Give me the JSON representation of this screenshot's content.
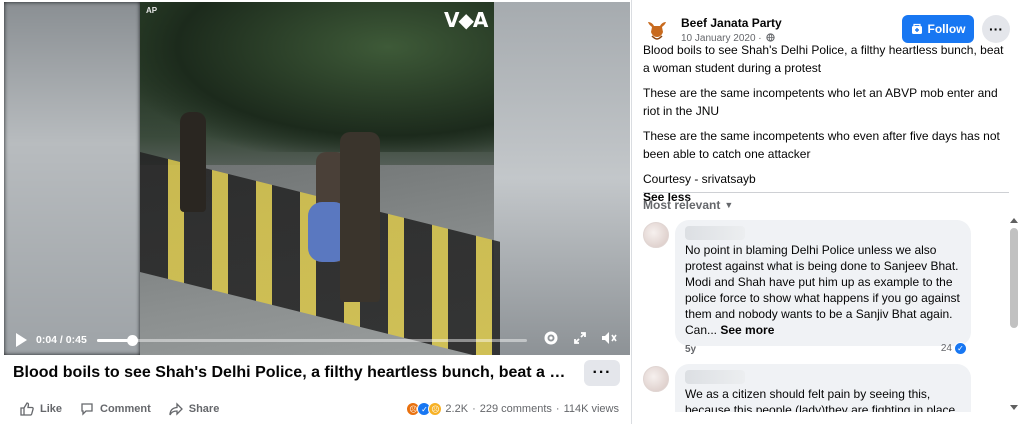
{
  "video": {
    "agency_mark": "AP",
    "channel_logo": "V◆A",
    "time_current": "0:04",
    "time_total": "0:45",
    "progress": 0.083,
    "icons": [
      "play-icon",
      "settings-icon",
      "fullscreen-icon",
      "volume-icon"
    ]
  },
  "post": {
    "title": "Blood boils to see Shah's Delhi Police, a filthy heartless bunch, beat a w...",
    "more_label": "···",
    "actions": {
      "like": "Like",
      "comment": "Comment",
      "share": "Share"
    },
    "stats": {
      "reactions_count": "2.2K",
      "comments": "229 comments",
      "views": "114K views",
      "separator": "·"
    }
  },
  "panel": {
    "page_name": "Beef Janata Party",
    "date": "10 January 2020 ·",
    "follow_label": "Follow",
    "menu_label": "···",
    "body": [
      "Blood boils to see Shah's Delhi Police, a filthy heartless bunch, beat a woman student during a protest",
      "These are the same incompetents who let an ABVP mob enter and riot in the JNU",
      "These are the same incompetents who even after five days has not been able to catch one attacker",
      "Courtesy - srivatsayb"
    ],
    "see_less": "See less",
    "sort_label": "Most relevant",
    "comments": [
      {
        "text": "No point in blaming Delhi Police unless we also protest against what is being done to Sanjeev Bhat. Modi and Shah have put him up as example to the police force to show what happens if you go against them and nobody wants to be a Sanjiv Bhat again. Can...",
        "see_more": "See more",
        "age": "5y",
        "likes": "24"
      },
      {
        "text": "We as a citizen should felt pain by seeing this, because this people (lady)they are fighting in place",
        "see_more": "",
        "age": "",
        "likes": ""
      }
    ]
  },
  "colors": {
    "brand_blue": "#1877f2",
    "secondary_text": "#65676b",
    "bubble_bg": "#f0f2f5",
    "button_grey": "#e4e6eb"
  }
}
